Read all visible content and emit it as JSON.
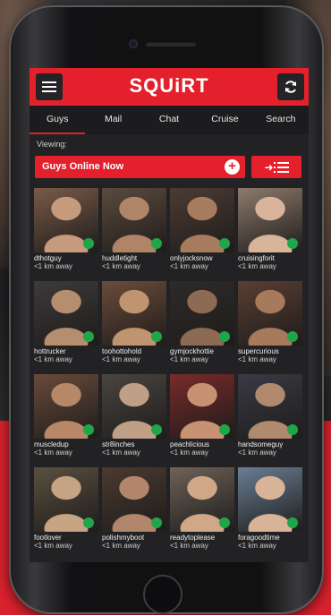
{
  "app": {
    "logo": "SQUiRT"
  },
  "tabs": [
    {
      "label": "Guys",
      "active": true
    },
    {
      "label": "Mail",
      "active": false
    },
    {
      "label": "Chat",
      "active": false
    },
    {
      "label": "Cruise",
      "active": false
    },
    {
      "label": "Search",
      "active": false
    }
  ],
  "viewing_label": "Viewing:",
  "filter": {
    "label": "Guys Online Now"
  },
  "colors": {
    "brand": "#e4202c",
    "online": "#1fa64a",
    "screen_bg": "#222224"
  },
  "profiles": [
    {
      "name": "dthotguy",
      "distance": "<1 km away",
      "online": true
    },
    {
      "name": "huddletight",
      "distance": "<1 km away",
      "online": true
    },
    {
      "name": "onlyjocksnow",
      "distance": "<1 km away",
      "online": true
    },
    {
      "name": "cruisingforit",
      "distance": "<1 km away",
      "online": true
    },
    {
      "name": "hottrucker",
      "distance": "<1 km away",
      "online": true
    },
    {
      "name": "toohottohold",
      "distance": "<1 km away",
      "online": true
    },
    {
      "name": "gymjockhottie",
      "distance": "<1 km away",
      "online": true
    },
    {
      "name": "supercurious",
      "distance": "<1 km away",
      "online": true
    },
    {
      "name": "muscledup",
      "distance": "<1 km away",
      "online": true
    },
    {
      "name": "str8inches",
      "distance": "<1 km away",
      "online": true
    },
    {
      "name": "peachlicious",
      "distance": "<1 km away",
      "online": true
    },
    {
      "name": "handsomeguy",
      "distance": "<1 km away",
      "online": true
    },
    {
      "name": "footlover",
      "distance": "<1 km away",
      "online": true
    },
    {
      "name": "polishmyboot",
      "distance": "<1 km away",
      "online": true
    },
    {
      "name": "readytoplease",
      "distance": "<1 km away",
      "online": true
    },
    {
      "name": "foragoodtime",
      "distance": "<1 km away",
      "online": true
    }
  ]
}
